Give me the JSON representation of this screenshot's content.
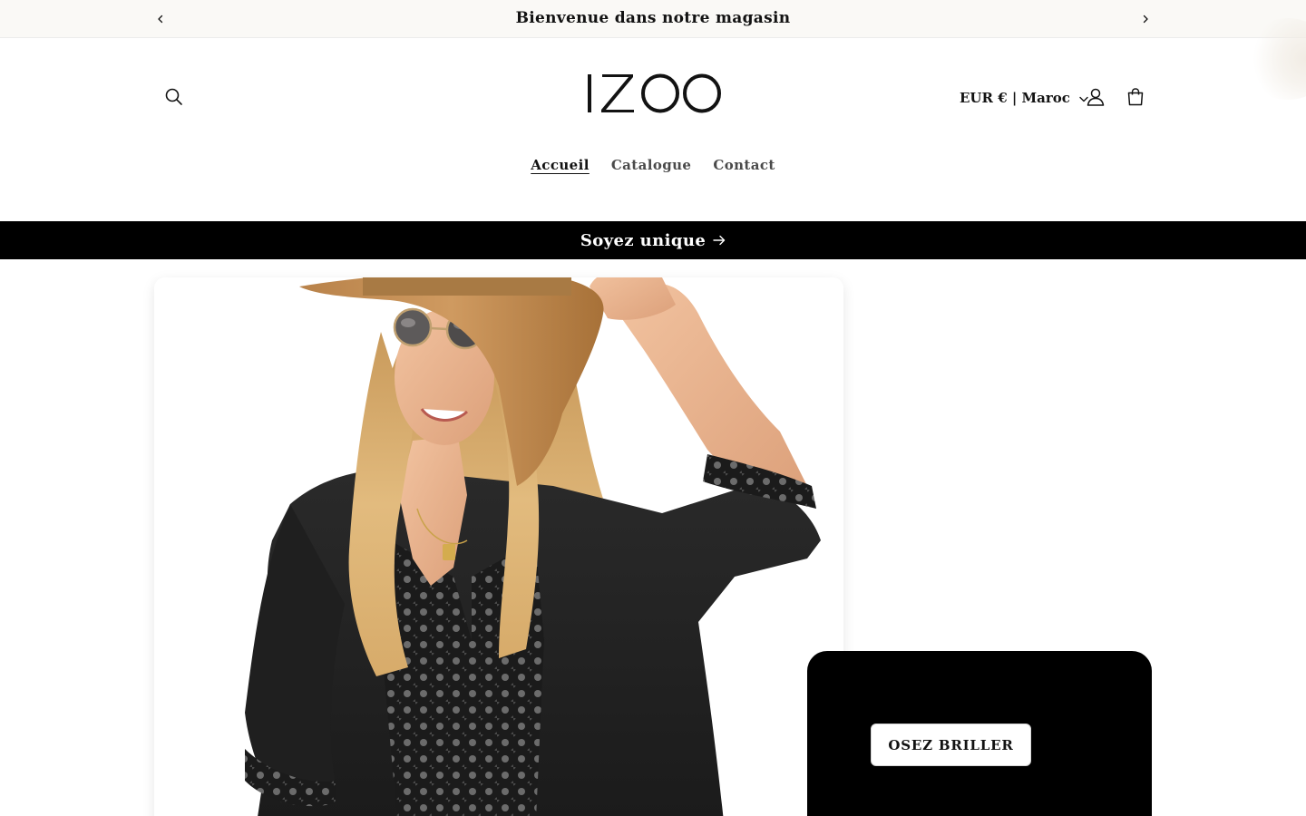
{
  "announcement": {
    "text": "Bienvenue dans notre magasin",
    "prev_icon": "chevron-left-icon",
    "next_icon": "chevron-right-icon"
  },
  "header": {
    "logo_text": "IZOO",
    "currency_label": "EUR € | Maroc",
    "icons": [
      "search-icon",
      "account-icon",
      "cart-icon",
      "chevron-down-icon"
    ]
  },
  "nav": {
    "items": [
      {
        "label": "Accueil",
        "active": true
      },
      {
        "label": "Catalogue",
        "active": false
      },
      {
        "label": "Contact",
        "active": false
      }
    ]
  },
  "promo_bar": {
    "label": "Soyez unique",
    "icon": "arrow-right-icon"
  },
  "hero": {
    "image_alt": "Femme blonde en chapeau de paille et lunettes de soleil portant une tunique noire en dentelle",
    "cta_label": "OSEZ BRILLER"
  },
  "colors": {
    "announcement_bg": "#faf9f6",
    "promo_bg": "#000000",
    "cta_card_bg": "#000000",
    "text": "#121212"
  }
}
